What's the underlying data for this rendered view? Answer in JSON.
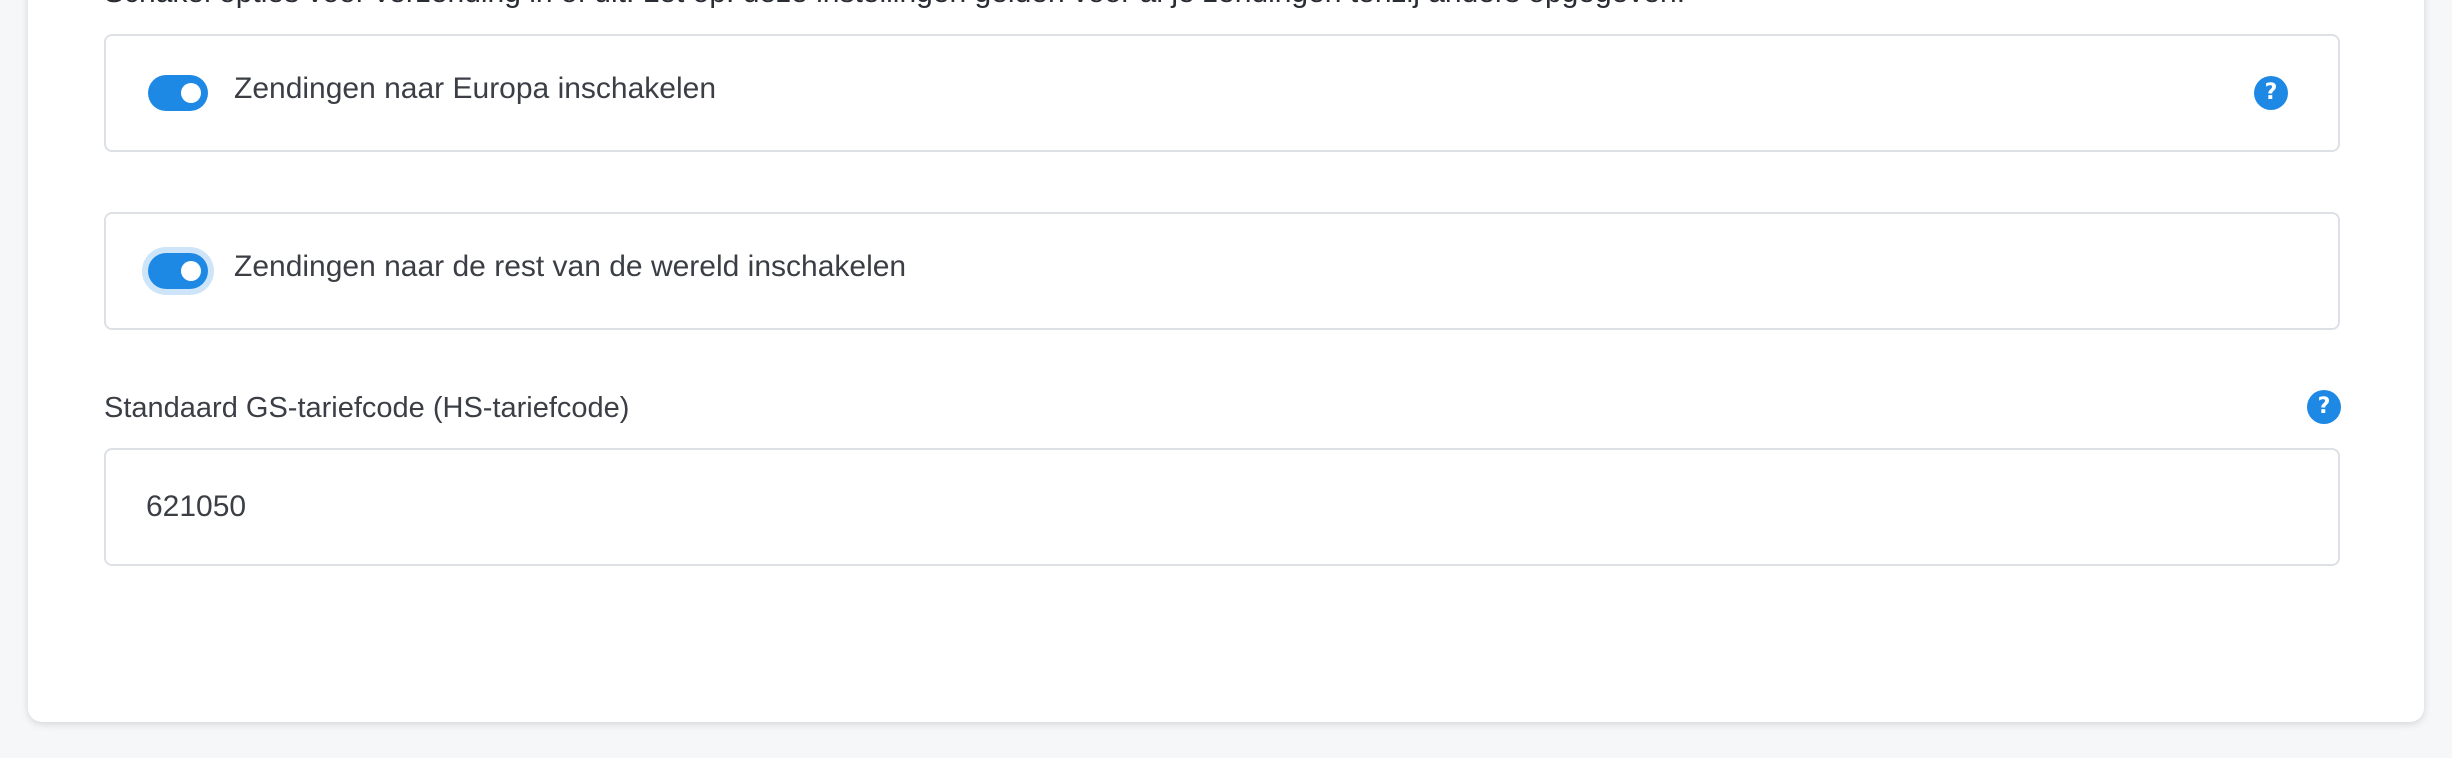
{
  "header": {
    "cut_text": "Schakel opties voor verzending in of uit. Let op: deze instellingen gelden voor al je zendingen tenzij anders opgegeven."
  },
  "toggles": [
    {
      "label": "Zendingen naar Europa inschakelen",
      "enabled": true,
      "focused": false,
      "help_icon": "question-icon"
    },
    {
      "label": "Zendingen naar de rest van de wereld inschakelen",
      "enabled": true,
      "focused": true
    }
  ],
  "tariff_field": {
    "label": "Standaard GS-tariefcode (HS-tariefcode)",
    "value": "621050",
    "help_icon": "question-icon"
  },
  "colors": {
    "accent": "#1e88e5",
    "border": "#dde1e6",
    "text": "#3b3f45",
    "background": "#f6f7f9"
  }
}
